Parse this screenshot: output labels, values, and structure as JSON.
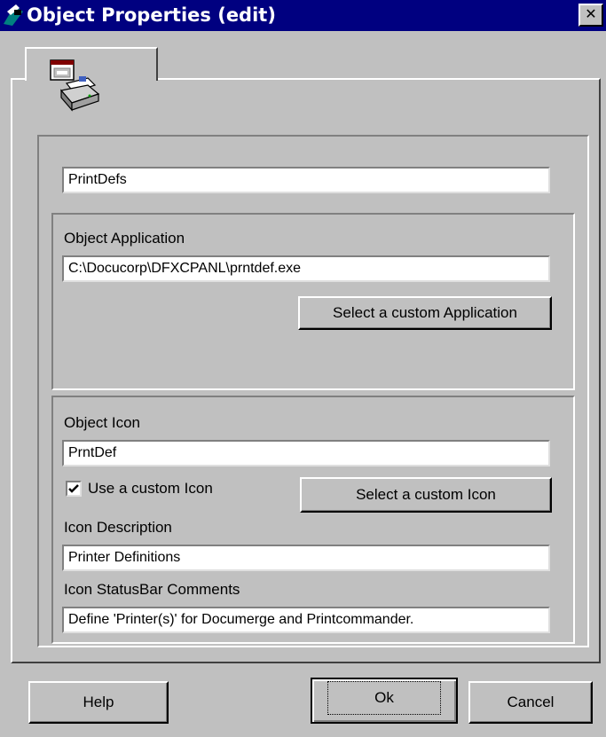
{
  "window": {
    "title": "Object Properties (edit)",
    "close_glyph": "✕"
  },
  "general": {
    "name_value": "PrintDefs"
  },
  "application": {
    "label": "Object Application",
    "path_value": "C:\\Docucorp\\DFXCPANL\\prntdef.exe",
    "select_button": "Select a custom Application"
  },
  "icon": {
    "label": "Object Icon",
    "icon_value": "PrntDef",
    "use_custom_label": "Use a custom Icon",
    "use_custom_checked": true,
    "select_button": "Select a custom Icon",
    "description_label": "Icon Description",
    "description_value": "Printer Definitions",
    "statusbar_label": "Icon StatusBar Comments",
    "statusbar_value": "Define 'Printer(s)' for Documerge and Printcommander."
  },
  "buttons": {
    "help": "Help",
    "ok": "Ok",
    "cancel": "Cancel"
  },
  "colors": {
    "titlebar": "#000080",
    "face": "#c0c0c0"
  },
  "icons": {
    "app": "app-window-icon",
    "tab": "printer-icon"
  }
}
